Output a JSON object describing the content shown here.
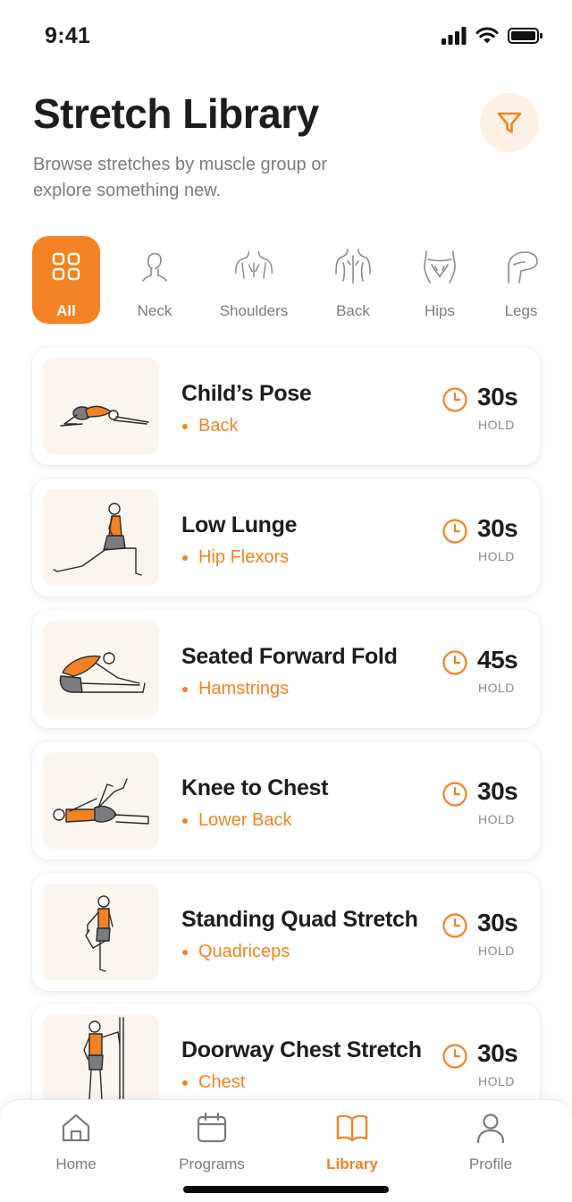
{
  "status_bar": {
    "time": "9:41"
  },
  "header": {
    "title": "Stretch Library",
    "subtitle": "Browse stretches by muscle group or explore something new."
  },
  "categories": [
    {
      "label": "All",
      "icon": "grid-icon",
      "active": true
    },
    {
      "label": "Neck",
      "icon": "neck-icon"
    },
    {
      "label": "Shoulders",
      "icon": "shoulders-icon"
    },
    {
      "label": "Back",
      "icon": "back-icon"
    },
    {
      "label": "Hips",
      "icon": "hips-icon"
    },
    {
      "label": "Legs",
      "icon": "legs-icon"
    }
  ],
  "stretches": [
    {
      "name": "Child’s Pose",
      "muscle": "Back",
      "duration": "30s",
      "hold_label": "HOLD",
      "illustration": "childs-pose-illustration"
    },
    {
      "name": "Low Lunge",
      "muscle": "Hip Flexors",
      "duration": "30s",
      "hold_label": "HOLD",
      "illustration": "low-lunge-illustration"
    },
    {
      "name": "Seated Forward Fold",
      "muscle": "Hamstrings",
      "duration": "45s",
      "hold_label": "HOLD",
      "illustration": "seated-forward-fold-illustration"
    },
    {
      "name": "Knee to Chest",
      "muscle": "Lower Back",
      "duration": "30s",
      "hold_label": "HOLD",
      "illustration": "knee-to-chest-illustration"
    },
    {
      "name": "Standing Quad Stretch",
      "muscle": "Quadriceps",
      "duration": "30s",
      "hold_label": "HOLD",
      "illustration": "standing-quad-stretch-illustration"
    },
    {
      "name": "Doorway Chest Stretch",
      "muscle": "Chest",
      "duration": "30s",
      "hold_label": "HOLD",
      "illustration": "doorway-chest-stretch-illustration"
    }
  ],
  "tab_bar": [
    {
      "label": "Home",
      "icon": "home-icon"
    },
    {
      "label": "Programs",
      "icon": "calendar-icon"
    },
    {
      "label": "Library",
      "icon": "book-icon",
      "active": true
    },
    {
      "label": "Profile",
      "icon": "user-icon"
    }
  ],
  "colors": {
    "accent": "#f28223",
    "accent_soft": "#fdf1e6",
    "thumb_bg": "#faf5ef",
    "text": "#1d1d1f",
    "muted": "#7b7b80"
  }
}
